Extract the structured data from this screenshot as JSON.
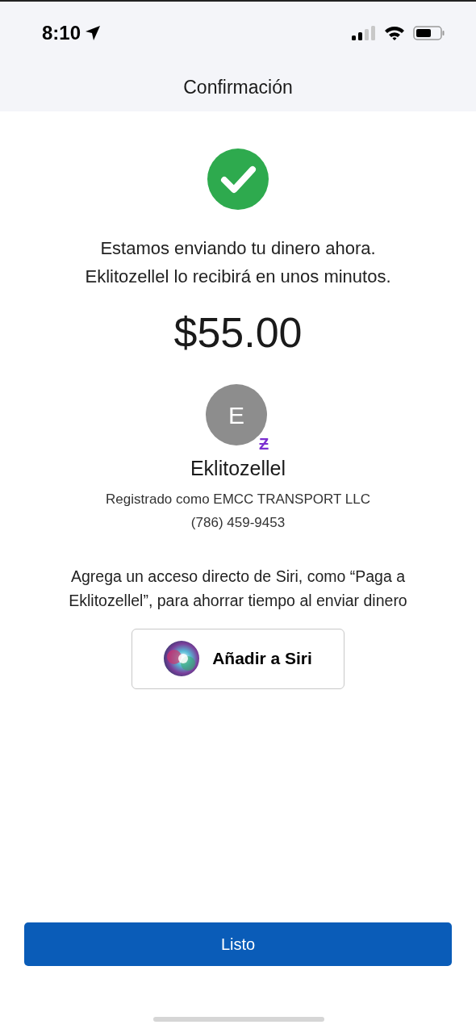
{
  "status_bar": {
    "time": "8:10"
  },
  "nav": {
    "title": "Confirmación"
  },
  "message": [
    "Estamos enviando tu dinero ahora.",
    "Eklitozellel lo recibirá en unos minutos."
  ],
  "amount": "$55.00",
  "recipient": {
    "initial": "E",
    "badge": "Ƶ",
    "name": "Eklitozellel",
    "registered": "Registrado como EMCC TRANSPORT LLC",
    "phone": "(786) 459-9453"
  },
  "siri": {
    "hint": "Agrega un acceso directo de Siri, como “Paga a Eklitozellel”, para ahorrar tiempo al enviar dinero",
    "button": "Añadir a Siri"
  },
  "done_button": "Listo"
}
